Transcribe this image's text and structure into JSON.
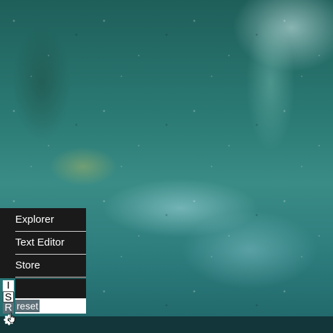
{
  "desktop": {
    "wallpaper": "rain-on-window",
    "accent": "#2b7a74",
    "taskbar_color": "#12363a"
  },
  "start_menu": {
    "items": [
      {
        "label": "Explorer"
      },
      {
        "label": "Text Editor"
      },
      {
        "label": "Store"
      }
    ]
  },
  "run_panel": {
    "letters": [
      "I",
      "S",
      "R"
    ],
    "input_value": "reset"
  },
  "start_button": {
    "icon": "flower-icon",
    "cursor": "hand-pointer-icon"
  }
}
